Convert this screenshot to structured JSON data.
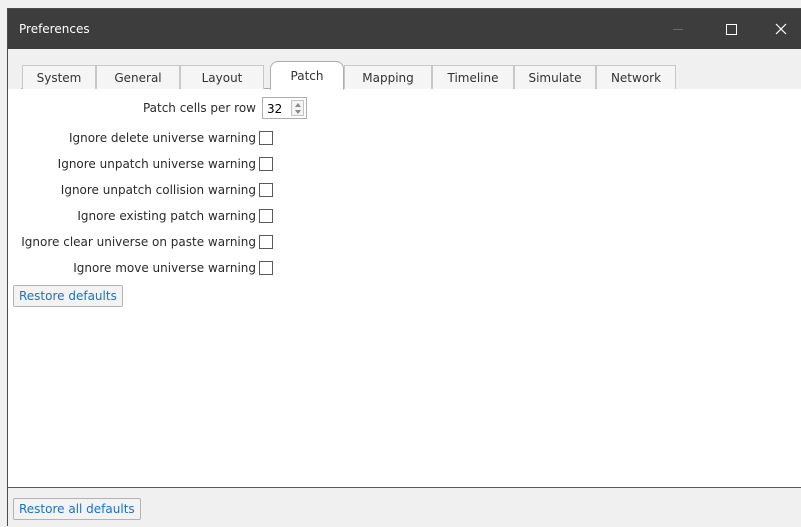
{
  "window": {
    "title": "Preferences"
  },
  "tabs": [
    {
      "label": "System"
    },
    {
      "label": "General"
    },
    {
      "label": "Layout"
    },
    {
      "label": "Patch"
    },
    {
      "label": "Mapping"
    },
    {
      "label": "Timeline"
    },
    {
      "label": "Simulate"
    },
    {
      "label": "Network"
    }
  ],
  "active_tab": "Patch",
  "patch": {
    "cells_per_row_label": "Patch cells per row",
    "cells_per_row_value": "32",
    "options": [
      {
        "label": "Ignore delete universe warning",
        "checked": false
      },
      {
        "label": "Ignore unpatch universe warning",
        "checked": false
      },
      {
        "label": "Ignore unpatch collision warning",
        "checked": false
      },
      {
        "label": "Ignore existing patch warning",
        "checked": false
      },
      {
        "label": "Ignore clear universe on paste warning",
        "checked": false
      },
      {
        "label": "Ignore move universe warning",
        "checked": false
      }
    ],
    "restore_defaults_label": "Restore defaults"
  },
  "footer": {
    "restore_all_label": "Restore all defaults"
  },
  "colors": {
    "titlebar": "#3d3d3d",
    "link_text": "#1473cc"
  }
}
